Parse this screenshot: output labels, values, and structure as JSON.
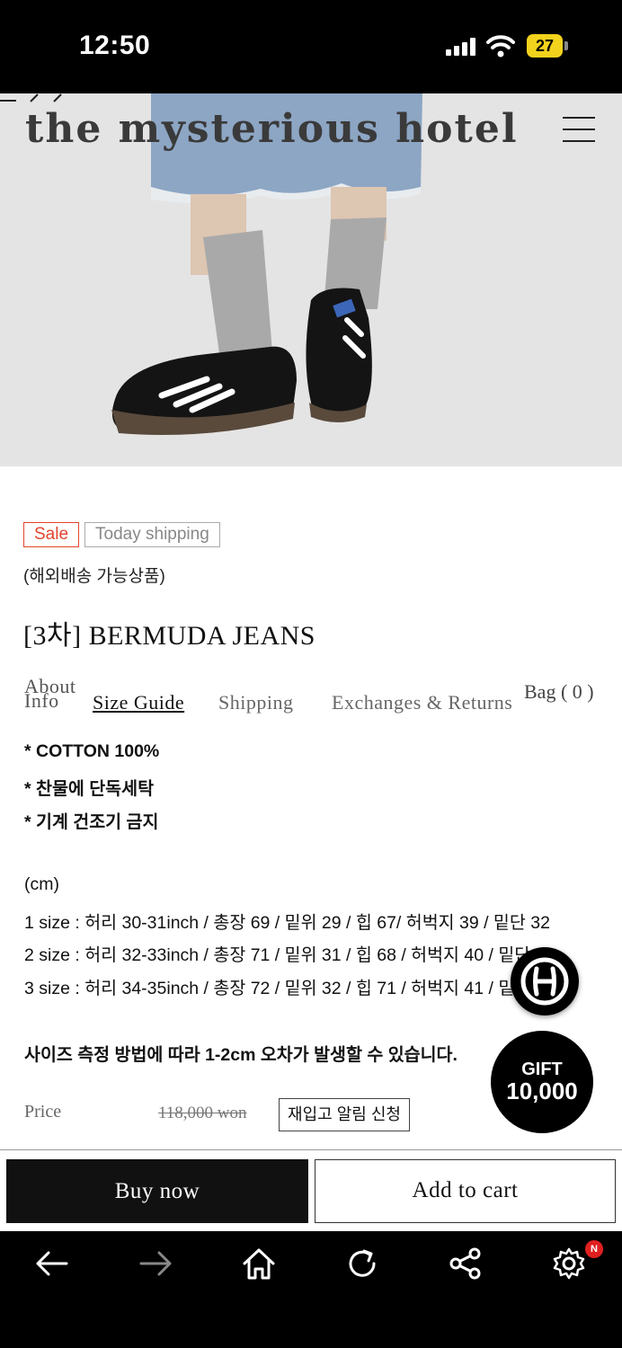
{
  "status_bar": {
    "time": "12:50",
    "battery": "27"
  },
  "header": {
    "logo": "the mysterious hotel"
  },
  "product": {
    "badges": {
      "sale": "Sale",
      "shipping": "Today shipping"
    },
    "overseas_note": "(해외배송 가능상품)",
    "title": "[3차] BERMUDA JEANS"
  },
  "tabs": {
    "about_line1": "About",
    "about_line2": "Info",
    "size_guide": "Size Guide",
    "shipping": "Shipping",
    "exchanges": "Exchanges & Returns",
    "bag": "Bag ( 0 )"
  },
  "description": {
    "line1": "* COTTON 100%",
    "line2": "* 찬물에 단독세탁",
    "line3": "* 기계 건조기 금지",
    "unit": "(cm)",
    "size1": "1 size : 허리 30-31inch / 총장 69 / 밑위 29 / 힙 67/ 허벅지 39 / 밑단 32",
    "size2": "2 size : 허리 32-33inch / 총장 71 / 밑위 31 / 힙 68 / 허벅지 40 / 밑단 33",
    "size3": "3 size : 허리 34-35inch / 총장 72 / 밑위 32 / 힙 71 / 허벅지 41 / 밑단 34",
    "note": "사이즈 측정 방법에 따라 1-2cm 오차가 발생할 수 있습니다."
  },
  "price": {
    "label": "Price",
    "original": "118,000 won",
    "restock_button": "재입고 알림 신청"
  },
  "floating": {
    "gift_title": "GIFT",
    "gift_amount": "10,000"
  },
  "actions": {
    "buy_now": "Buy now",
    "add_to_cart": "Add to cart"
  },
  "browser": {
    "notification_badge": "N"
  }
}
